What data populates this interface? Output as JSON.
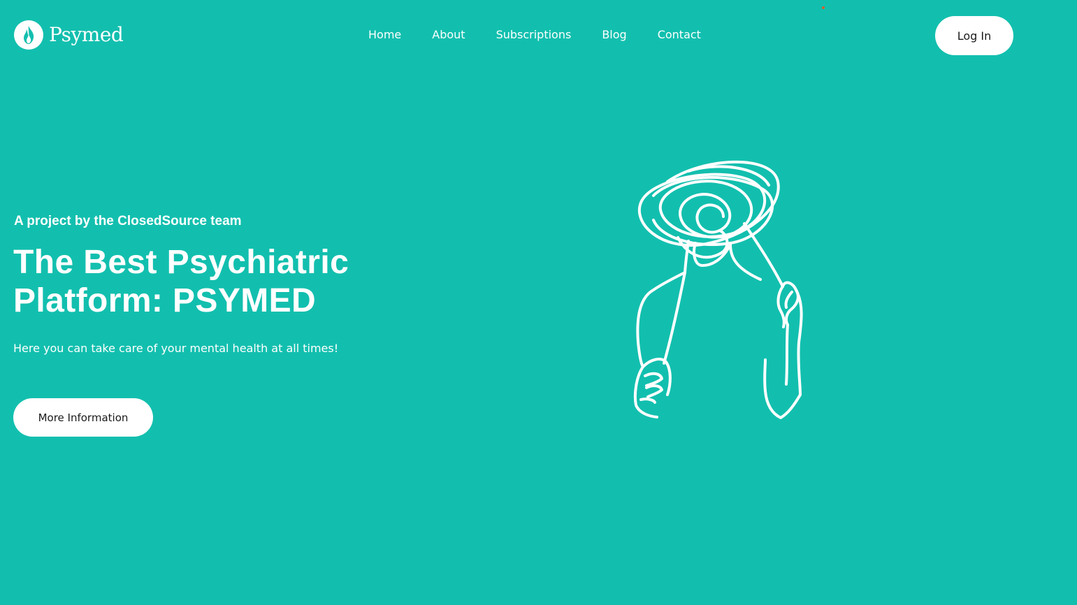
{
  "brand": {
    "name": "Psymed",
    "icon": "flame-icon"
  },
  "nav": {
    "items": [
      {
        "label": "Home"
      },
      {
        "label": "About"
      },
      {
        "label": "Subscriptions"
      },
      {
        "label": "Blog"
      },
      {
        "label": "Contact"
      }
    ]
  },
  "header": {
    "login_label": "Log In"
  },
  "hero": {
    "eyebrow": "A project by the ClosedSource team",
    "title_line1": "The Best Psychiatric",
    "title_line2": "Platform: PSYMED",
    "subtitle": "Here you can take care of your mental health at all times!",
    "cta_label": "More Information",
    "illustration": "tangled-mind-person-illustration"
  },
  "colors": {
    "background": "#12BFAE",
    "text": "#FFFFFF",
    "button_bg": "#FFFFFF",
    "button_text": "#1A1A1A"
  }
}
